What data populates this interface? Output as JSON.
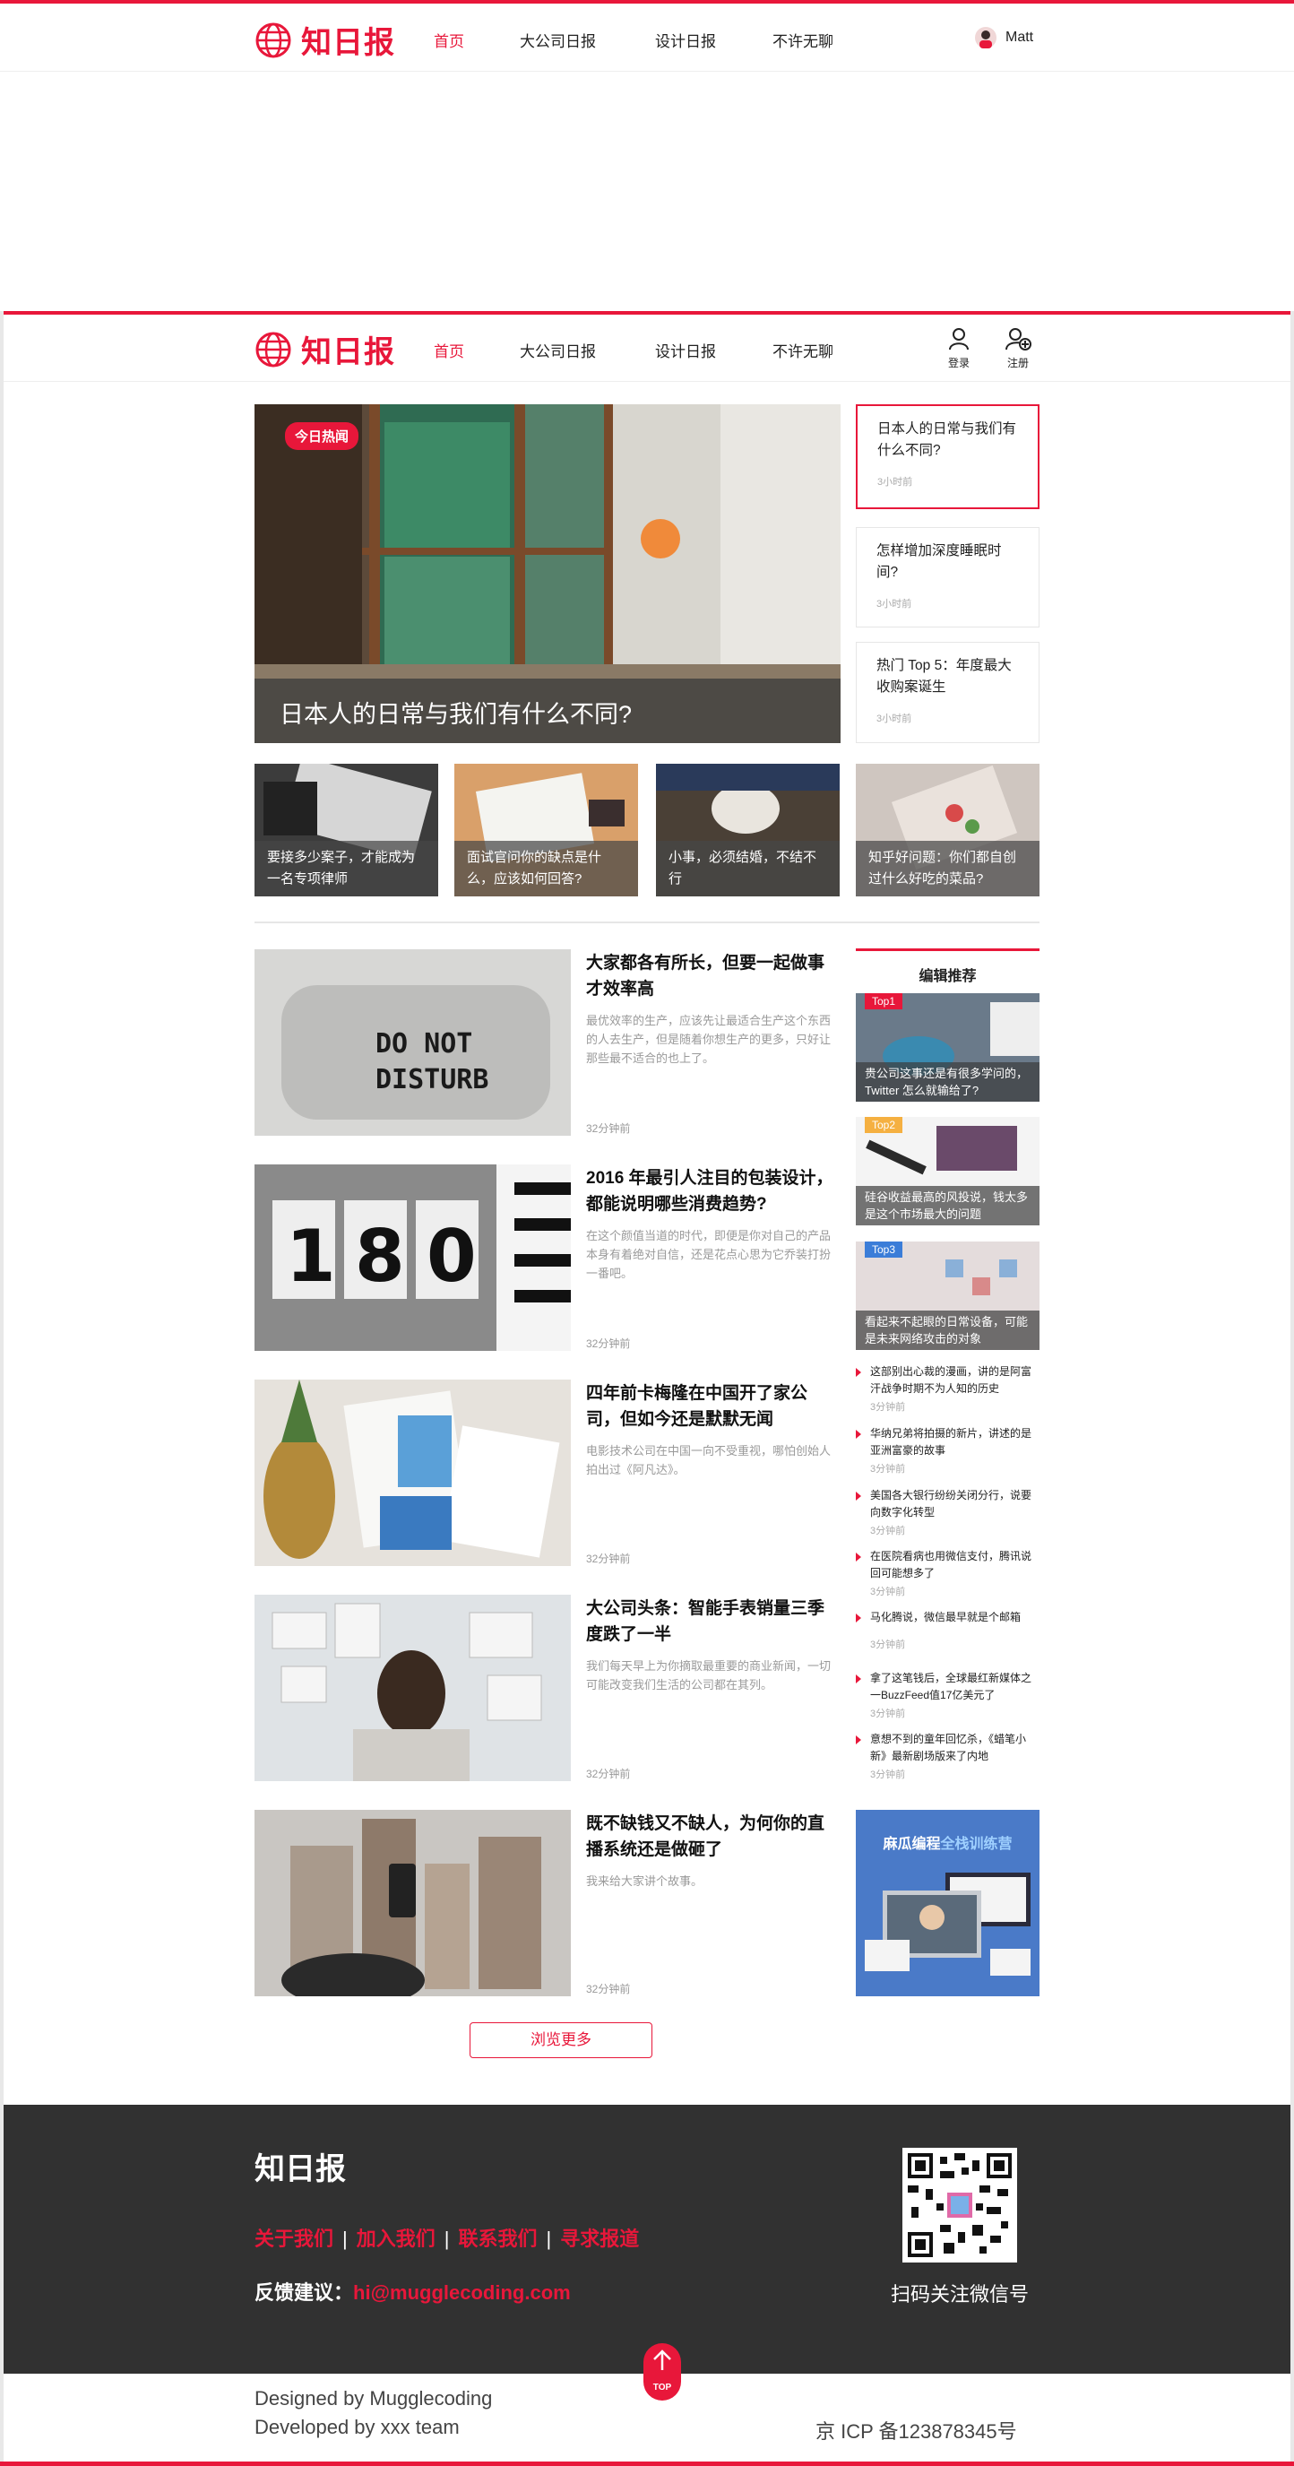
{
  "brand": {
    "name": "知日报",
    "accent": "#e8173a"
  },
  "nav": {
    "items": [
      "首页",
      "大公司日报",
      "设计日报",
      "不许无聊"
    ]
  },
  "top_header": {
    "user_name": "Matt"
  },
  "main_header": {
    "login_label": "登录",
    "register_label": "注册"
  },
  "hero": {
    "badge": "今日热闻",
    "title": "日本人的日常与我们有什么不同?"
  },
  "side_news": [
    {
      "title": "日本人的日常与我们有什么不同?",
      "time": "3小时前"
    },
    {
      "title": "怎样增加深度睡眠时间?",
      "time": "3小时前"
    },
    {
      "title": "热门 Top 5：年度最大收购案诞生",
      "time": "3小时前"
    }
  ],
  "thumbs": [
    {
      "caption": "要接多少案子，才能成为一名专项律师"
    },
    {
      "caption": "面试官问你的缺点是什么，应该如何回答?"
    },
    {
      "caption": "小事，必须结婚，不结不行"
    },
    {
      "caption": "知乎好问题：你们都自创过什么好吃的菜品?"
    }
  ],
  "articles": [
    {
      "title": "大家都各有所长，但要一起做事才效率高",
      "desc": "最优效率的生产，应该先让最适合生产这个东西的人去生产，但是随着你想生产的更多，只好让那些最不适合的也上了。",
      "time": "32分钟前"
    },
    {
      "title": "2016 年最引人注目的包装设计，都能说明哪些消费趋势?",
      "desc": "在这个颜值当道的时代，即便是你对自己的产品本身有着绝对自信，还是花点心思为它乔装打扮一番吧。",
      "time": "32分钟前"
    },
    {
      "title": "四年前卡梅隆在中国开了家公司，但如今还是默默无闻",
      "desc": "电影技术公司在中国一向不受重视，哪怕创始人拍出过《阿凡达》。",
      "time": "32分钟前"
    },
    {
      "title": "大公司头条：智能手表销量三季度跌了一半",
      "desc": "我们每天早上为你摘取最重要的商业新闻，一切可能改变我们生活的公司都在其列。",
      "time": "32分钟前"
    },
    {
      "title": "既不缺钱又不缺人，为何你的直播系统还是做砸了",
      "desc": "我来给大家讲个故事。",
      "time": "32分钟前"
    }
  ],
  "editor": {
    "heading": "编辑推荐",
    "top": [
      {
        "tag": "Top1",
        "tag_color": "#e8173a",
        "caption": "贵公司这事还是有很多学问的，Twitter 怎么就输给了?"
      },
      {
        "tag": "Top2",
        "tag_color": "#f5b041",
        "caption": "硅谷收益最高的风投说，钱太多是这个市场最大的问题"
      },
      {
        "tag": "Top3",
        "tag_color": "#3b7dd8",
        "caption": "看起来不起眼的日常设备，可能是未来网络攻击的对象"
      }
    ],
    "list": [
      {
        "title": "这部别出心裁的漫画，讲的是阿富汗战争时期不为人知的历史",
        "time": "3分钟前"
      },
      {
        "title": "华纳兄弟将拍摄的新片，讲述的是亚洲富豪的故事",
        "time": "3分钟前"
      },
      {
        "title": "美国各大银行纷纷关闭分行，说要向数字化转型",
        "time": "3分钟前"
      },
      {
        "title": "在医院看病也用微信支付，腾讯说回可能想多了",
        "time": "3分钟前"
      },
      {
        "title": "马化腾说，微信最早就是个邮箱",
        "time": "3分钟前"
      },
      {
        "title": "拿了这笔钱后，全球最红新媒体之一BuzzFeed值17亿美元了",
        "time": "3分钟前"
      },
      {
        "title": "意想不到的童年回忆杀，《蜡笔小新》最新剧场版来了内地",
        "time": "3分钟前"
      }
    ],
    "ad": {
      "title_white": "麻瓜编程",
      "title_blue": "全栈训练营"
    }
  },
  "more_button": "浏览更多",
  "footer": {
    "logo": "知日报",
    "links": [
      "关于我们",
      "加入我们",
      "联系我们",
      "寻求报道"
    ],
    "feedback_label": "反馈建议：",
    "email": "hi@mugglecoding.com",
    "qr_label": "扫码关注微信号",
    "top_label": "TOP"
  },
  "bottom": {
    "designed_by": "Designed by Mugglecoding",
    "developed_by": "Developed by xxx team",
    "icp": "京 ICP 备123878345号"
  }
}
